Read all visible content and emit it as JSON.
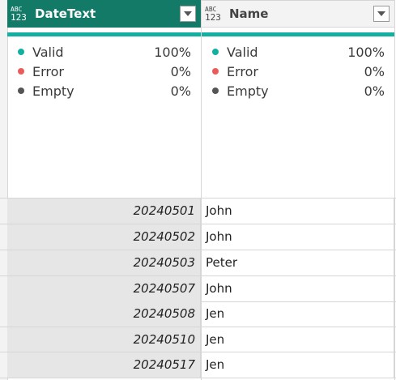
{
  "columns": [
    {
      "type_icon_top": "ABC",
      "type_icon_bottom": "123",
      "title": "DateText",
      "quality": [
        {
          "label": "Valid",
          "value": "100%",
          "color": "#13b0a1"
        },
        {
          "label": "Error",
          "value": "0%",
          "color": "#e85c5c"
        },
        {
          "label": "Empty",
          "value": "0%",
          "color": "#555555"
        }
      ]
    },
    {
      "type_icon_top": "ABC",
      "type_icon_bottom": "123",
      "title": "Name",
      "quality": [
        {
          "label": "Valid",
          "value": "100%",
          "color": "#13b0a1"
        },
        {
          "label": "Error",
          "value": "0%",
          "color": "#e85c5c"
        },
        {
          "label": "Empty",
          "value": "0%",
          "color": "#555555"
        }
      ]
    }
  ],
  "rows": [
    {
      "date": "20240501",
      "name": "John"
    },
    {
      "date": "20240502",
      "name": "John"
    },
    {
      "date": "20240503",
      "name": "Peter"
    },
    {
      "date": "20240507",
      "name": "John"
    },
    {
      "date": "20240508",
      "name": "Jen"
    },
    {
      "date": "20240510",
      "name": "Jen"
    },
    {
      "date": "20240517",
      "name": "Jen"
    }
  ],
  "colors": {
    "selected_header": "#137a68",
    "quality_bar": "#13b0a1"
  }
}
